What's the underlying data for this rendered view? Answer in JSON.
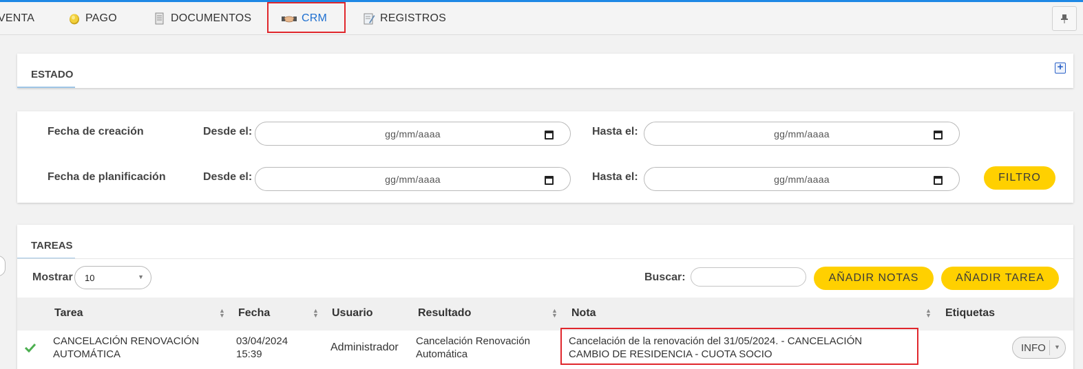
{
  "nav": {
    "items": [
      {
        "label": "VENTA",
        "icon": "venta-icon"
      },
      {
        "label": "PAGO",
        "icon": "coin-icon"
      },
      {
        "label": "DOCUMENTOS",
        "icon": "documents-icon"
      },
      {
        "label": "CRM",
        "icon": "handshake-icon",
        "active": true
      },
      {
        "label": "REGISTROS",
        "icon": "registry-icon"
      }
    ],
    "pin_icon": "pin-icon"
  },
  "estado": {
    "title": "ESTADO",
    "expand_icon": "plus-icon"
  },
  "filters": {
    "creacion_label": "Fecha de creación",
    "planificacion_label": "Fecha de planificación",
    "desde_label": "Desde el:",
    "hasta_label": "Hasta el:",
    "date_placeholder": "gg/mm/aaaa",
    "filter_button": "FILTRO"
  },
  "tareas": {
    "title": "TAREAS",
    "mostrar_label": "Mostrar",
    "page_size": "10",
    "buscar_label": "Buscar:",
    "add_notes_button": "AÑADIR NOTAS",
    "add_task_button": "AÑADIR TAREA",
    "columns": [
      "Tarea",
      "Fecha",
      "Usuario",
      "Resultado",
      "Nota",
      "Etiquetas"
    ],
    "rows": [
      {
        "status_icon": "check-icon",
        "tarea": [
          "CANCELACIÓN RENOVACIÓN",
          "AUTOMÁTICA"
        ],
        "fecha": [
          "03/04/2024",
          "15:39"
        ],
        "usuario": "Administrador",
        "resultado": [
          "Cancelación Renovación",
          "Automática"
        ],
        "nota": [
          "Cancelación de la renovación del 31/05/2024. - CANCELACIÓN",
          "CAMBIO DE RESIDENCIA - CUOTA SOCIO"
        ],
        "action": "INFO"
      }
    ]
  },
  "colors": {
    "accent_blue": "#1e88e5",
    "highlight_red": "#e0262b",
    "button_yellow": "#ffd000",
    "check_green": "#4caf50"
  }
}
